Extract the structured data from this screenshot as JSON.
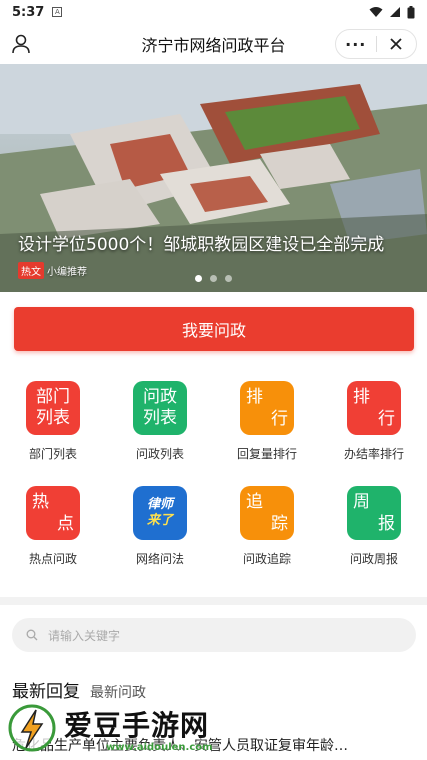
{
  "status_bar": {
    "time": "5:37",
    "a_badge": "A"
  },
  "header": {
    "title": "济宁市网络问政平台",
    "more_label": "···"
  },
  "banner": {
    "title": "设计学位5000个！邹城职教园区建设已全部完成",
    "tag": "热文",
    "source": "小编推荐",
    "slides": 3,
    "active_slide": 0
  },
  "ask_button": {
    "label": "我要问政"
  },
  "grid": [
    {
      "tile": [
        "部门",
        "列表"
      ],
      "label": "部门列表",
      "color": "#f03f35",
      "style": "two-line"
    },
    {
      "tile": [
        "问政",
        "列表"
      ],
      "label": "问政列表",
      "color": "#1fb36b",
      "style": "two-line"
    },
    {
      "tile": [
        "排",
        "行"
      ],
      "label": "回复量排行",
      "color": "#f7900a",
      "style": "diag"
    },
    {
      "tile": [
        "排",
        "行"
      ],
      "label": "办结率排行",
      "color": "#f03f35",
      "style": "diag"
    },
    {
      "tile": [
        "热",
        "点"
      ],
      "label": "热点问政",
      "color": "#f03f35",
      "style": "diag"
    },
    {
      "tile": [
        "律师",
        "来了"
      ],
      "label": "网络问法",
      "color": "#1f6fd0",
      "style": "badge"
    },
    {
      "tile": [
        "追",
        "踪"
      ],
      "label": "问政追踪",
      "color": "#f7900a",
      "style": "diag"
    },
    {
      "tile": [
        "周",
        "报"
      ],
      "label": "问政周报",
      "color": "#1fb36b",
      "style": "diag"
    }
  ],
  "search": {
    "placeholder": "请输入关键字"
  },
  "tabs": {
    "active": "最新回复",
    "other": "最新问政"
  },
  "news": [
    "危化品生产单位主要负责人、安管人员取证复审年龄…"
  ],
  "watermark": {
    "text": "爱豆手游网",
    "url": "www.aidoulen.com"
  }
}
